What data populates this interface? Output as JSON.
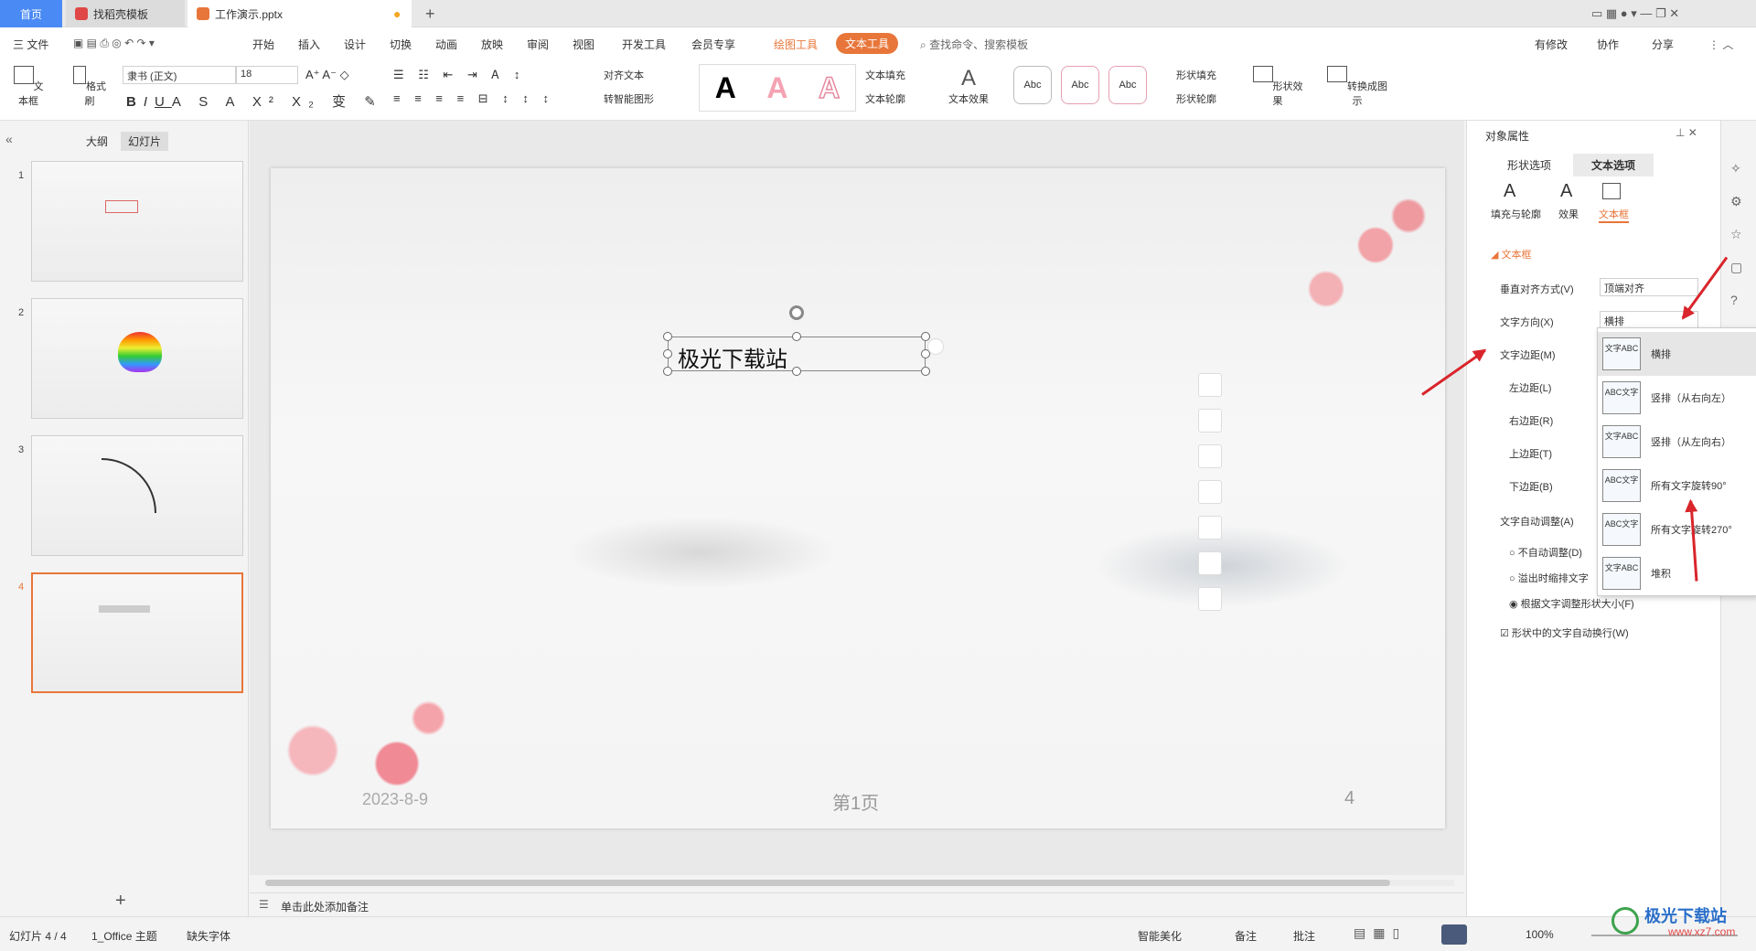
{
  "tabs": {
    "home": "首页",
    "template": "找稻壳模板",
    "doc": "工作演示.pptx",
    "add": "+"
  },
  "menu": {
    "file": "三 文件",
    "items": [
      "开始",
      "插入",
      "设计",
      "切换",
      "动画",
      "放映",
      "审阅",
      "视图",
      "开发工具",
      "会员专享"
    ],
    "drawing_tools": "绘图工具",
    "text_tools": "文本工具",
    "search": "查找命令、搜索模板",
    "modified": "有修改",
    "collab": "协作",
    "share": "分享"
  },
  "ribbon": {
    "textbox": "文本框",
    "format_painter": "格式刷",
    "font": "隶书 (正文)",
    "size": "18",
    "align_text": "对齐文本",
    "smart_shape": "转智能图形",
    "text_fill": "文本填充",
    "text_outline": "文本轮廓",
    "text_effect": "文本效果",
    "shape_fill": "形状填充",
    "shape_outline": "形状轮廓",
    "shape_effect": "形状效果",
    "convert": "转换成图示",
    "style_abc": "Abc",
    "big_a": "A"
  },
  "left": {
    "outline_tab": "大纲",
    "slides_tab": "幻灯片",
    "slide_numbers": [
      "1",
      "2",
      "3",
      "4"
    ],
    "add": "+"
  },
  "slide": {
    "textbox": "极光下载站",
    "date": "2023-8-9",
    "page": "第1页",
    "number": "4"
  },
  "notes": "单击此处添加备注",
  "panel": {
    "title": "对象属性",
    "tab_shape": "形状选项",
    "tab_text": "文本选项",
    "sub_fill": "填充与轮廓",
    "sub_effect": "效果",
    "sub_textbox": "文本框",
    "section": "文本框",
    "valign": "垂直对齐方式(V)",
    "valign_value": "顶端对齐",
    "direction": "文字方向(X)",
    "direction_value": "横排",
    "margin": "文字边距(M)",
    "left_margin": "左边距(L)",
    "right_margin": "右边距(R)",
    "top_margin": "上边距(T)",
    "bottom_margin": "下边距(B)",
    "autofit": "文字自动调整(A)",
    "opt_none": "不自动调整(D)",
    "opt_shrink": "溢出时缩排文字",
    "opt_resize": "根据文字调整形状大小(F)",
    "wrap": "形状中的文字自动换行(W)"
  },
  "dropdown": [
    {
      "label": "横排",
      "icon": "文字ABC"
    },
    {
      "label": "竖排（从右向左）",
      "icon": "ABC文字"
    },
    {
      "label": "竖排（从左向右）",
      "icon": "文字ABC"
    },
    {
      "label": "所有文字旋转90°",
      "icon": "ABC文字"
    },
    {
      "label": "所有文字旋转270°",
      "icon": "ABC文字"
    },
    {
      "label": "堆积",
      "icon": "文字ABC"
    }
  ],
  "status": {
    "slide": "幻灯片 4 / 4",
    "theme": "1_Office 主题",
    "missing_font": "缺失字体",
    "beautify": "智能美化",
    "notes": "备注",
    "comment": "批注",
    "zoom": "100%"
  },
  "watermark": "极光下载站",
  "watermark_url": "www.xz7.com",
  "colors": {
    "accent": "#4a8af4",
    "tool_tab": "#e8763a",
    "arrow": "#d9252b"
  }
}
